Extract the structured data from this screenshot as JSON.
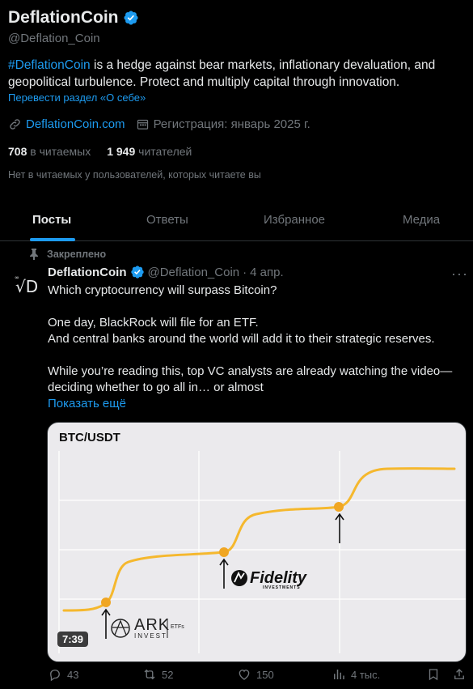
{
  "profile": {
    "name": "DeflationCoin",
    "handle": "@Deflation_Coin",
    "bio_tag": "#DeflationCoin",
    "bio_text": " is a hedge against bear markets, inflationary devaluation, and geopolitical turbulence. Protect and multiply capital through innovation.",
    "translate_link": "Перевести раздел «О себе»",
    "website": "DeflationCoin.com",
    "joined": "Регистрация: январь 2025 г.",
    "following_count": "708",
    "following_label": "в читаемых",
    "followers_count": "1 949",
    "followers_label": "читателей",
    "no_common_followers": "Нет в читаемых у пользователей, которых читаете вы",
    "verified_color": "#1d9bf0"
  },
  "tabs": [
    {
      "label": "Посты",
      "active": true
    },
    {
      "label": "Ответы",
      "active": false
    },
    {
      "label": "Избранное",
      "active": false
    },
    {
      "label": "Медиа",
      "active": false
    }
  ],
  "pinned_post": {
    "pinned_label": "Закреплено",
    "author_name": "DeflationCoin",
    "author_handle": "@Deflation_Coin",
    "dot": "·",
    "date": "4 апр.",
    "lines": [
      "Which cryptocurrency will surpass Bitcoin?",
      "",
      "One day, BlackRock will file for an ETF.",
      "And central banks around the world will add it to their strategic reserves.",
      "",
      "While you’re reading this, top VC analysts are already watching the video—",
      "deciding whether to go all in… or almost"
    ],
    "show_more": "Показать ещё",
    "media": {
      "chart_title": "BTC/USDT",
      "duration": "7:39",
      "ark_label": "ARK",
      "ark_sub": "INVEST",
      "ark_etfs": "ETFs",
      "fidelity_label": "Fidelity",
      "fidelity_sub": "INVESTMENTS",
      "line_color": "#f5b82e"
    },
    "stats": {
      "replies": "43",
      "reposts": "52",
      "likes": "150",
      "views": "4 тыс."
    }
  }
}
